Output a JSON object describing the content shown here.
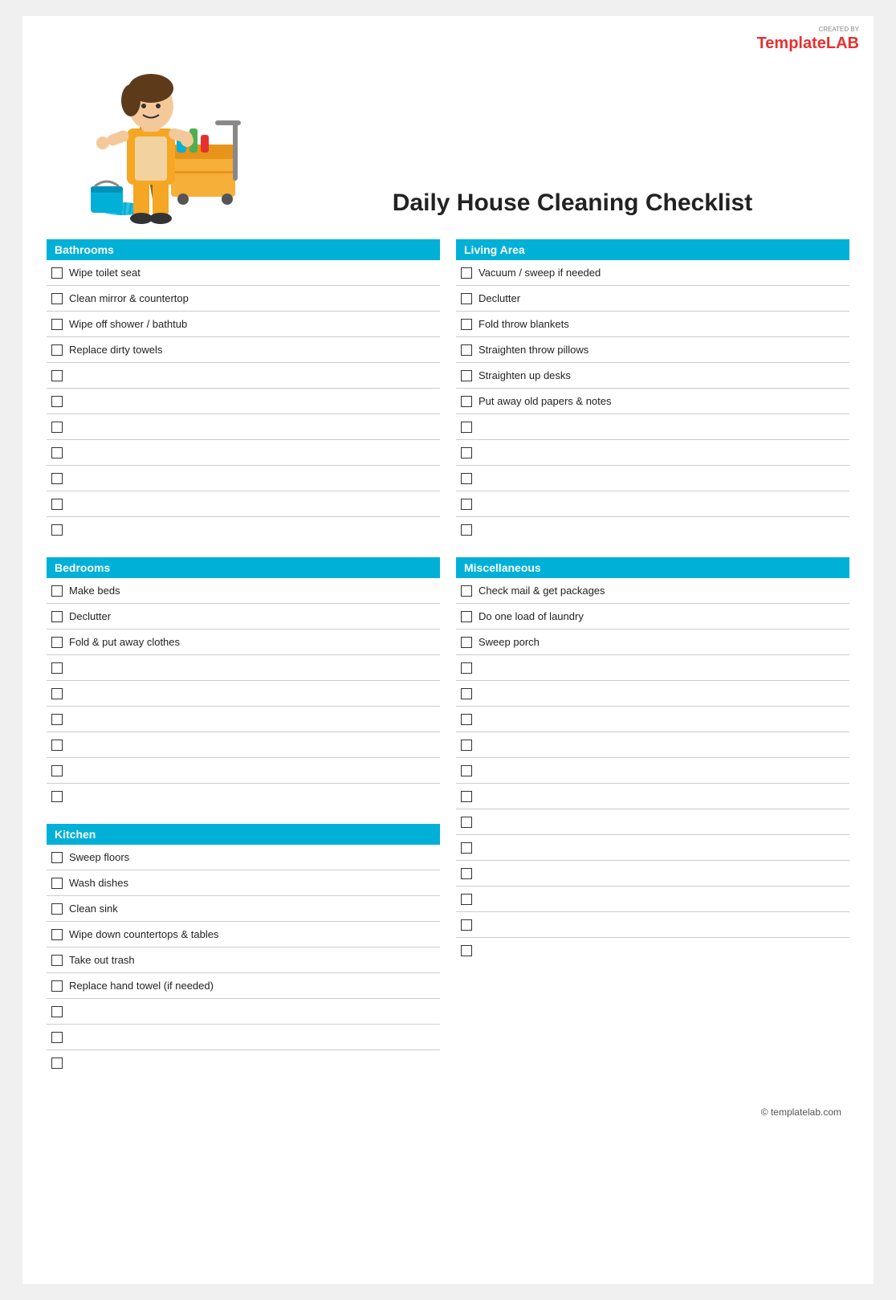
{
  "logo": {
    "created_by": "CREATED BY",
    "brand_part1": "Template",
    "brand_part2": "LAB"
  },
  "title": "Daily House Cleaning Checklist",
  "footer": "© templatelab.com",
  "sections": [
    {
      "id": "bathrooms",
      "header": "Bathrooms",
      "column": "left",
      "items": [
        "Wipe toilet seat",
        "Clean mirror & countertop",
        "Wipe off shower / bathtub",
        "Replace dirty towels",
        "",
        "",
        "",
        "",
        "",
        "",
        ""
      ]
    },
    {
      "id": "living-area",
      "header": "Living Area",
      "column": "right",
      "items": [
        "Vacuum / sweep if needed",
        "Declutter",
        "Fold throw blankets",
        "Straighten throw pillows",
        "Straighten up desks",
        "Put away old papers & notes",
        "",
        "",
        "",
        "",
        ""
      ]
    },
    {
      "id": "bedrooms",
      "header": "Bedrooms",
      "column": "left",
      "items": [
        "Make beds",
        "Declutter",
        "Fold & put away clothes",
        "",
        "",
        "",
        "",
        "",
        ""
      ]
    },
    {
      "id": "miscellaneous",
      "header": "Miscellaneous",
      "column": "right",
      "items": [
        "Check mail & get packages",
        "Do one load of laundry",
        "Sweep porch",
        "",
        "",
        "",
        "",
        "",
        "",
        "",
        "",
        "",
        "",
        "",
        ""
      ]
    },
    {
      "id": "kitchen",
      "header": "Kitchen",
      "column": "left",
      "items": [
        "Sweep floors",
        "Wash dishes",
        "Clean sink",
        "Wipe down countertops & tables",
        "Take out trash",
        "Replace hand towel (if needed)",
        "",
        "",
        ""
      ]
    }
  ]
}
